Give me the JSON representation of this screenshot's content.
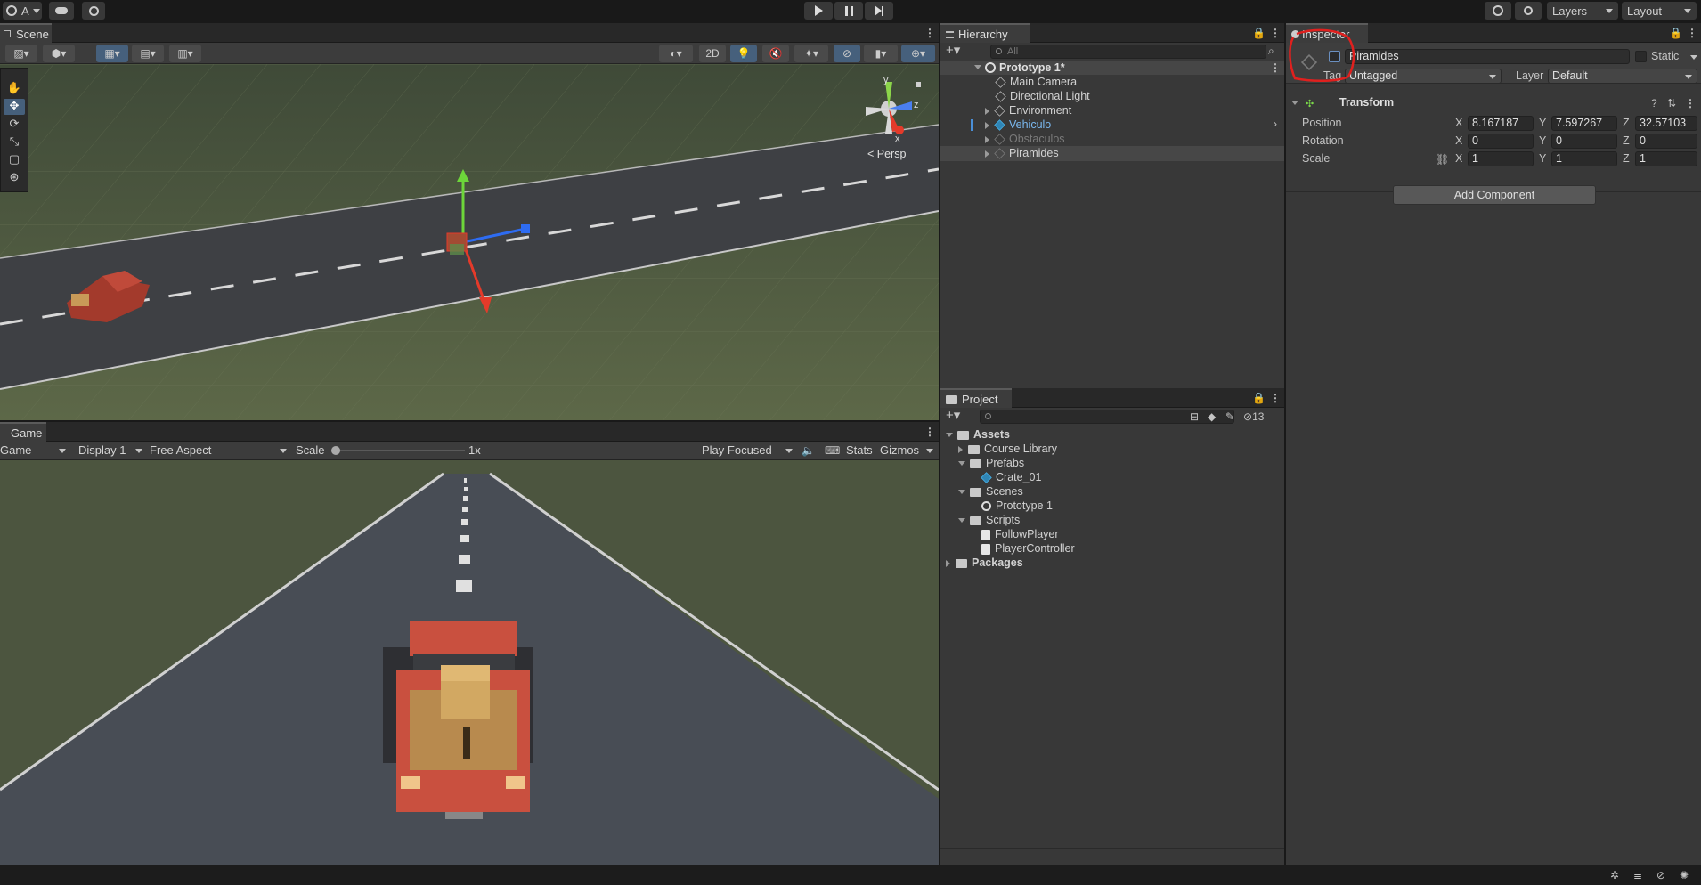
{
  "topbar": {
    "account_label": "A",
    "layers_label": "Layers",
    "layout_label": "Layout"
  },
  "scene": {
    "tab_label": "Scene",
    "btn_2d": "2D",
    "persp_label": "< Persp",
    "gizmo_y": "y",
    "gizmo_z": "z",
    "gizmo_x": "x"
  },
  "game": {
    "tab_label": "Game",
    "mode_label": "Game",
    "display_label": "Display 1",
    "aspect_label": "Free Aspect",
    "scale_label": "Scale",
    "scale_value": "1x",
    "play_focused_label": "Play Focused",
    "stats_label": "Stats",
    "gizmos_label": "Gizmos"
  },
  "hierarchy": {
    "tab_label": "Hierarchy",
    "search_placeholder": "All",
    "root": "Prototype 1*",
    "items": [
      {
        "label": "Main Camera",
        "type": "obj"
      },
      {
        "label": "Directional Light",
        "type": "obj"
      },
      {
        "label": "Environment",
        "type": "obj-expand"
      },
      {
        "label": "Vehiculo",
        "type": "prefab"
      },
      {
        "label": "Obstaculos",
        "type": "disabled"
      },
      {
        "label": "Piramides",
        "type": "selected"
      }
    ]
  },
  "project": {
    "tab_label": "Project",
    "hidden_count": "13",
    "tree": [
      {
        "label": "Assets",
        "depth": 0,
        "kind": "folder-open",
        "bold": true
      },
      {
        "label": "Course Library",
        "depth": 1,
        "kind": "folder-closed"
      },
      {
        "label": "Prefabs",
        "depth": 1,
        "kind": "folder-open"
      },
      {
        "label": "Crate_01",
        "depth": 2,
        "kind": "prefab"
      },
      {
        "label": "Scenes",
        "depth": 1,
        "kind": "folder-open"
      },
      {
        "label": "Prototype 1",
        "depth": 2,
        "kind": "scene"
      },
      {
        "label": "Scripts",
        "depth": 1,
        "kind": "folder-open"
      },
      {
        "label": "FollowPlayer",
        "depth": 2,
        "kind": "script"
      },
      {
        "label": "PlayerController",
        "depth": 2,
        "kind": "script"
      },
      {
        "label": "Packages",
        "depth": 0,
        "kind": "folder-closed",
        "bold": true
      }
    ]
  },
  "inspector": {
    "tab_label": "Inspector",
    "object_name": "Piramides",
    "static_label": "Static",
    "tag_label": "Tag",
    "tag_value": "Untagged",
    "layer_label": "Layer",
    "layer_value": "Default",
    "transform_label": "Transform",
    "position_label": "Position",
    "rotation_label": "Rotation",
    "scale_label": "Scale",
    "axis_x": "X",
    "axis_y": "Y",
    "axis_z": "Z",
    "position": {
      "x": "8.167187",
      "y": "7.597267",
      "z": "32.57103"
    },
    "rotation": {
      "x": "0",
      "y": "0",
      "z": "0"
    },
    "scale": {
      "x": "1",
      "y": "1",
      "z": "1"
    },
    "add_component_label": "Add Component"
  },
  "colors": {
    "accent": "#46607c",
    "selection": "#2c5d87",
    "annotation": "#e0201e",
    "prefab_blue": "#6fb9f0"
  }
}
